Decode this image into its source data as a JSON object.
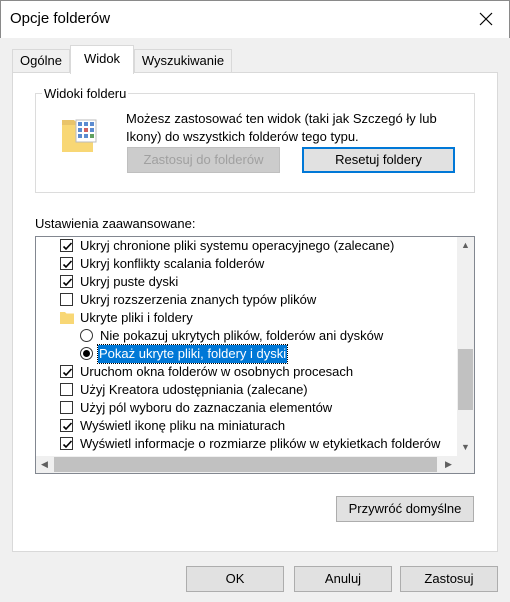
{
  "window": {
    "title": "Opcje folderów"
  },
  "tabs": [
    {
      "label": "Ogólne"
    },
    {
      "label": "Widok"
    },
    {
      "label": "Wyszukiwanie"
    }
  ],
  "folder_views": {
    "legend": "Widoki folderu",
    "description": "Możesz zastosować ten widok (taki jak Szczegó ły lub Ikony) do wszystkich folderów tego typu.",
    "apply_button": "Zastosuj do folderów",
    "reset_button": "Resetuj foldery"
  },
  "advanced": {
    "label": "Ustawienia zaawansowane:",
    "items": [
      {
        "type": "checkbox",
        "checked": true,
        "label": "Ukryj chronione pliki systemu operacyjnego (zalecane)"
      },
      {
        "type": "checkbox",
        "checked": true,
        "label": "Ukryj konflikty scalania folderów"
      },
      {
        "type": "checkbox",
        "checked": true,
        "label": "Ukryj puste dyski"
      },
      {
        "type": "checkbox",
        "checked": false,
        "label": "Ukryj rozszerzenia znanych typów plików"
      },
      {
        "type": "folder",
        "label": "Ukryte pliki i foldery"
      },
      {
        "type": "radio",
        "checked": false,
        "label": "Nie pokazuj ukrytych plików, folderów ani dysków"
      },
      {
        "type": "radio",
        "checked": true,
        "selected": true,
        "label": "Pokaż ukryte pliki, foldery i dyski"
      },
      {
        "type": "checkbox",
        "checked": true,
        "label": "Uruchom okna folderów w osobnych procesach"
      },
      {
        "type": "checkbox",
        "checked": false,
        "label": "Użyj Kreatora udostępniania (zalecane)"
      },
      {
        "type": "checkbox",
        "checked": false,
        "label": "Użyj pól wyboru do zaznaczania elementów"
      },
      {
        "type": "checkbox",
        "checked": true,
        "label": "Wyświetl ikonę pliku na miniaturach"
      },
      {
        "type": "checkbox",
        "checked": true,
        "label": "Wyświetl informacje o rozmiarze plików w etykietkach folderów"
      }
    ],
    "restore_button": "Przywróć domyślne"
  },
  "footer": {
    "ok": "OK",
    "cancel": "Anuluj",
    "apply": "Zastosuj"
  },
  "colors": {
    "accent": "#0078d7",
    "folder": "#f8d775"
  }
}
